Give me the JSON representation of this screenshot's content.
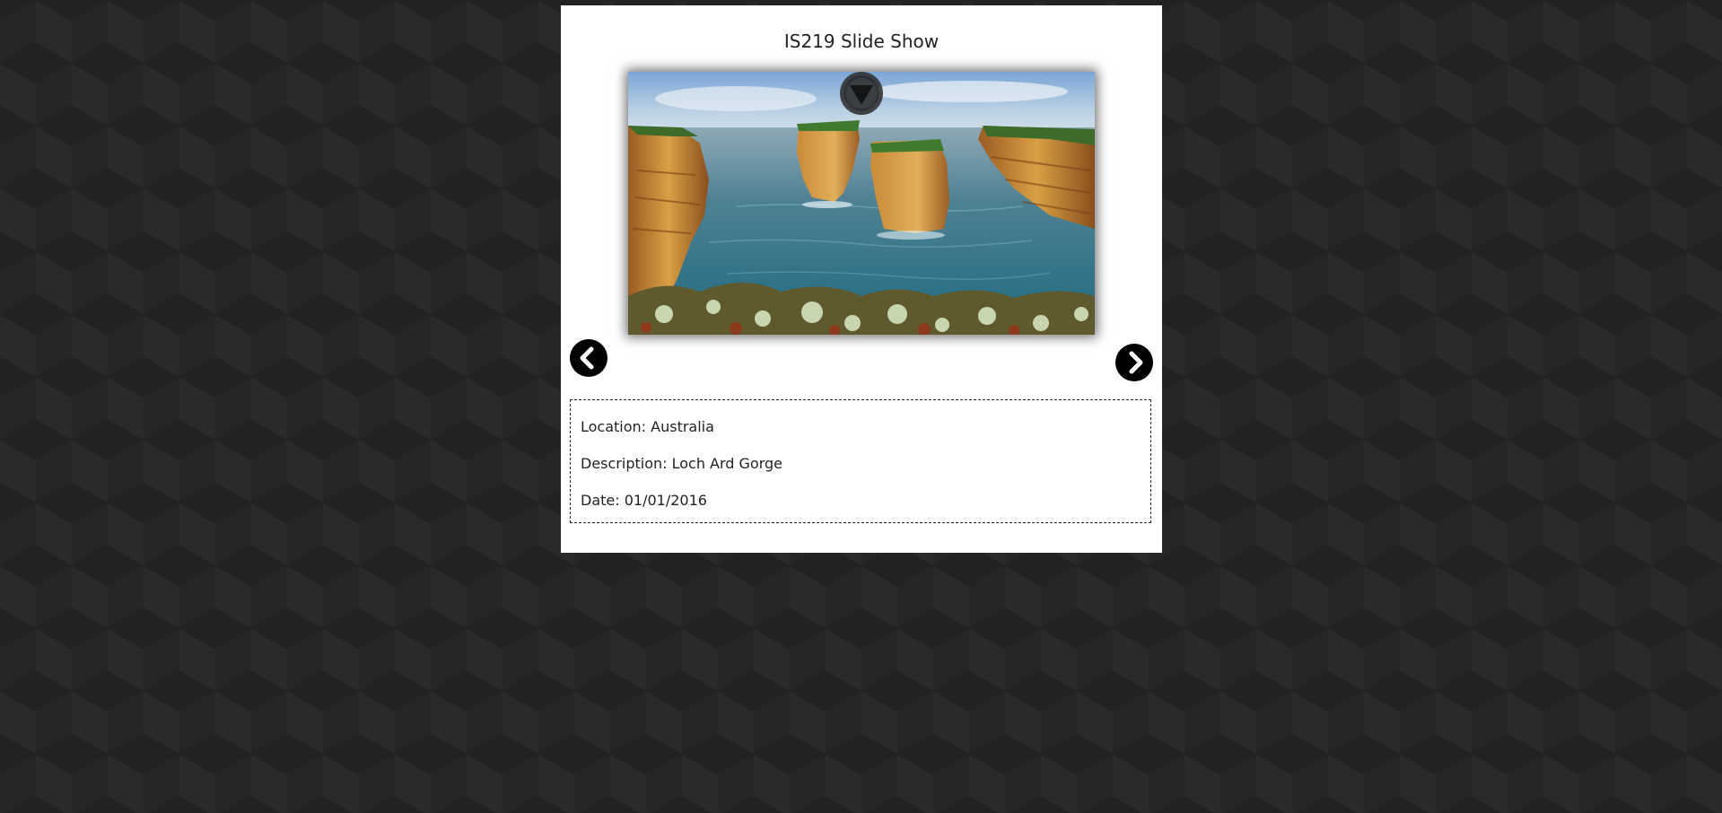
{
  "app": {
    "title": "IS219 Slide Show"
  },
  "slide": {
    "image_alt": "Loch Ard Gorge",
    "play_toggle_icon": "play-pause-down-triangle-icon"
  },
  "navigation": {
    "prev_icon": "chevron-left-icon",
    "next_icon": "chevron-right-icon"
  },
  "details": {
    "location": "Location: Australia",
    "description": "Description: Loch Ard Gorge",
    "date": "Date: 01/01/2016"
  },
  "colors": {
    "background": "#262626",
    "panel": "#ffffff",
    "button": "#000000",
    "text": "#222222"
  }
}
